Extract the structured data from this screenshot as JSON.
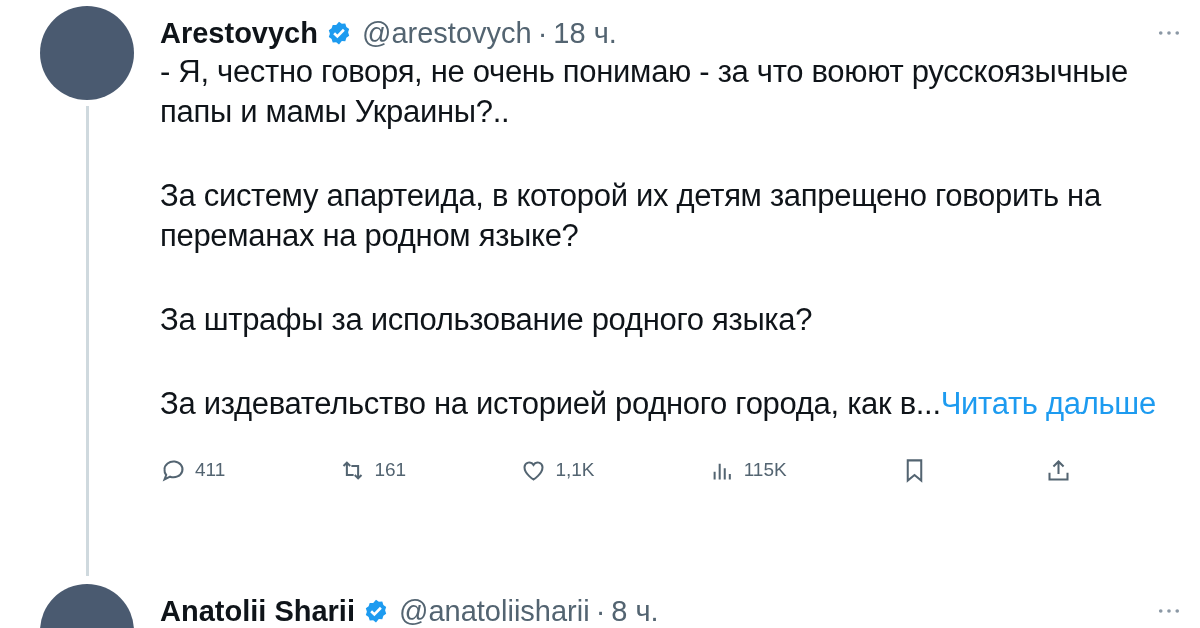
{
  "tweets": [
    {
      "name": "Arestovych",
      "verified": true,
      "handle": "@arestovych",
      "separator": "·",
      "time": "18 ч.",
      "thread_line": true,
      "paragraphs": [
        "- Я, честно говоря, не очень понимаю - за что воюют русскоязычные папы и мамы Украины?..",
        "За систему апартеида, в которой их детям запрещено говорить на переманах на родном языке?",
        "За штрафы за использование родного языка?",
        "За издевательство на историей родного города, как в..."
      ],
      "read_more": "Читать дальше",
      "actions": [
        {
          "kind": "reply",
          "count": "411"
        },
        {
          "kind": "retweet",
          "count": "161"
        },
        {
          "kind": "like",
          "count": "1,1K"
        },
        {
          "kind": "views",
          "count": "115K"
        },
        {
          "kind": "bookmark"
        },
        {
          "kind": "share"
        }
      ]
    },
    {
      "name": "Anatolii Sharii",
      "verified": true,
      "handle": "@anatoliisharii",
      "separator": "·",
      "time": "8 ч."
    }
  ]
}
